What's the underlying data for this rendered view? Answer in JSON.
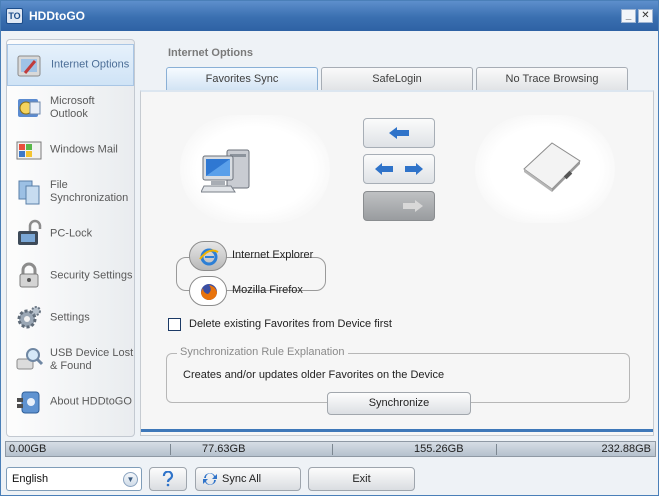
{
  "window": {
    "title": "HDDtoGO"
  },
  "sidebar": {
    "items": [
      {
        "label": "Internet Options",
        "icon": "internet-options-icon",
        "active": true
      },
      {
        "label": "Microsoft Outlook",
        "icon": "outlook-icon",
        "active": false
      },
      {
        "label": "Windows Mail",
        "icon": "windows-mail-icon",
        "active": false
      },
      {
        "label": "File Synchronization",
        "icon": "file-sync-icon",
        "active": false
      },
      {
        "label": "PC-Lock",
        "icon": "pc-lock-icon",
        "active": false
      },
      {
        "label": "Security Settings",
        "icon": "lock-icon",
        "active": false
      },
      {
        "label": "Settings",
        "icon": "gear-icon",
        "active": false
      },
      {
        "label": "USB Device Lost & Found",
        "icon": "magnifier-icon",
        "active": false
      },
      {
        "label": "About HDDtoGO",
        "icon": "about-icon",
        "active": false
      }
    ]
  },
  "main": {
    "section_title": "Internet Options",
    "tabs": [
      {
        "label": "Favorites Sync",
        "active": true
      },
      {
        "label": "SafeLogin",
        "active": false
      },
      {
        "label": "No Trace Browsing",
        "active": false
      }
    ],
    "browsers": [
      {
        "label": "Internet Explorer",
        "icon": "internet-explorer-icon"
      },
      {
        "label": "Mozilla Firefox",
        "icon": "firefox-icon"
      }
    ],
    "delete_checkbox": {
      "label": "Delete existing Favorites from Device first",
      "checked": false
    },
    "rule": {
      "title": "Synchronization Rule Explanation",
      "text": "Creates and/or updates older Favorites on the Device"
    },
    "synchronize_label": "Synchronize"
  },
  "statusbar": [
    "0.00GB",
    "77.63GB",
    "155.26GB",
    "232.88GB"
  ],
  "footer": {
    "language": "English",
    "sync_all_label": "Sync All",
    "exit_label": "Exit"
  },
  "colors": {
    "titlebar": "#3a6fb0",
    "accent": "#3e78b9",
    "arrow": "#2f73c9"
  }
}
